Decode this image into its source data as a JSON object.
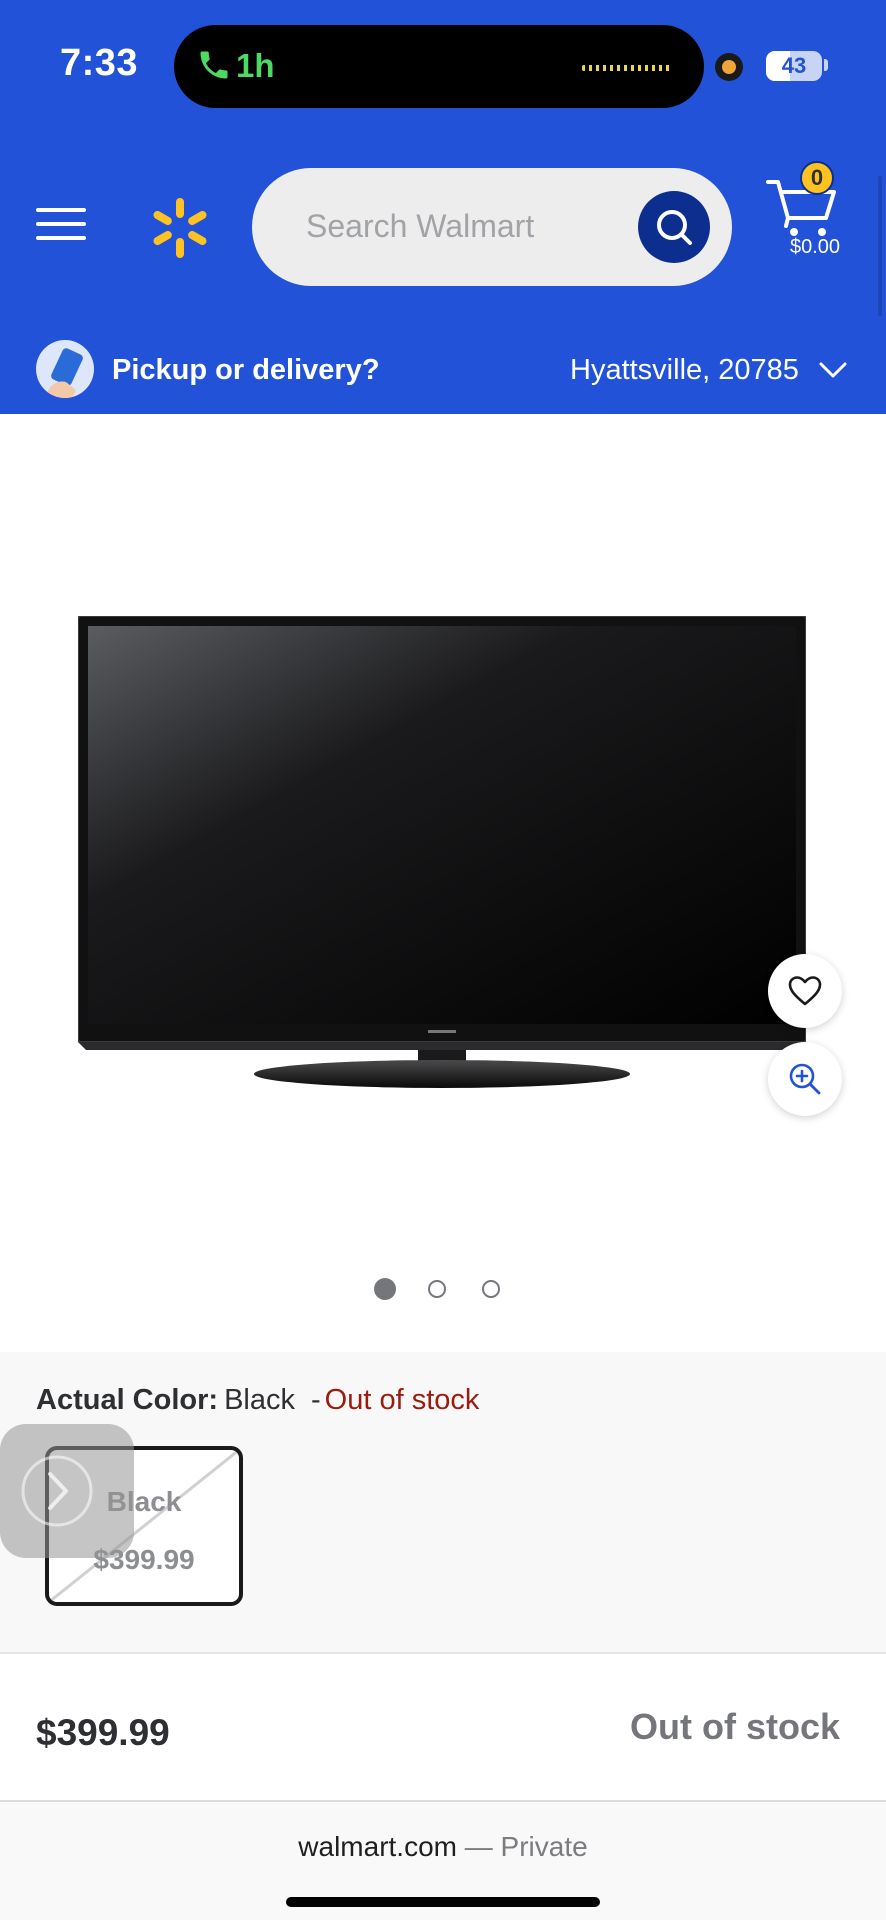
{
  "status_bar": {
    "time": "7:33",
    "call_duration": "1h",
    "battery_level": "43",
    "battery_fraction": 0.43
  },
  "header": {
    "search_placeholder": "Search Walmart",
    "cart_count": "0",
    "cart_total": "$0.00",
    "pickup_label": "Pickup or delivery?",
    "location": "Hyattsville, 20785",
    "colors": {
      "header_bg": "#2152d8",
      "spark": "#ffc220",
      "search_button": "#0c2e8f"
    }
  },
  "product": {
    "carousel_total": 3,
    "carousel_active_index": 0,
    "color_label": "Actual Color:",
    "color_value": "Black",
    "separator": "-",
    "stock_status": "Out of stock",
    "swatch": {
      "name": "Black",
      "price": "$399.99"
    },
    "price": "$399.99",
    "cta": "Out of stock",
    "colors": {
      "out_of_stock_text": "#9b1c0e"
    }
  },
  "browser": {
    "domain": "walmart.com",
    "mode": "— Private"
  }
}
